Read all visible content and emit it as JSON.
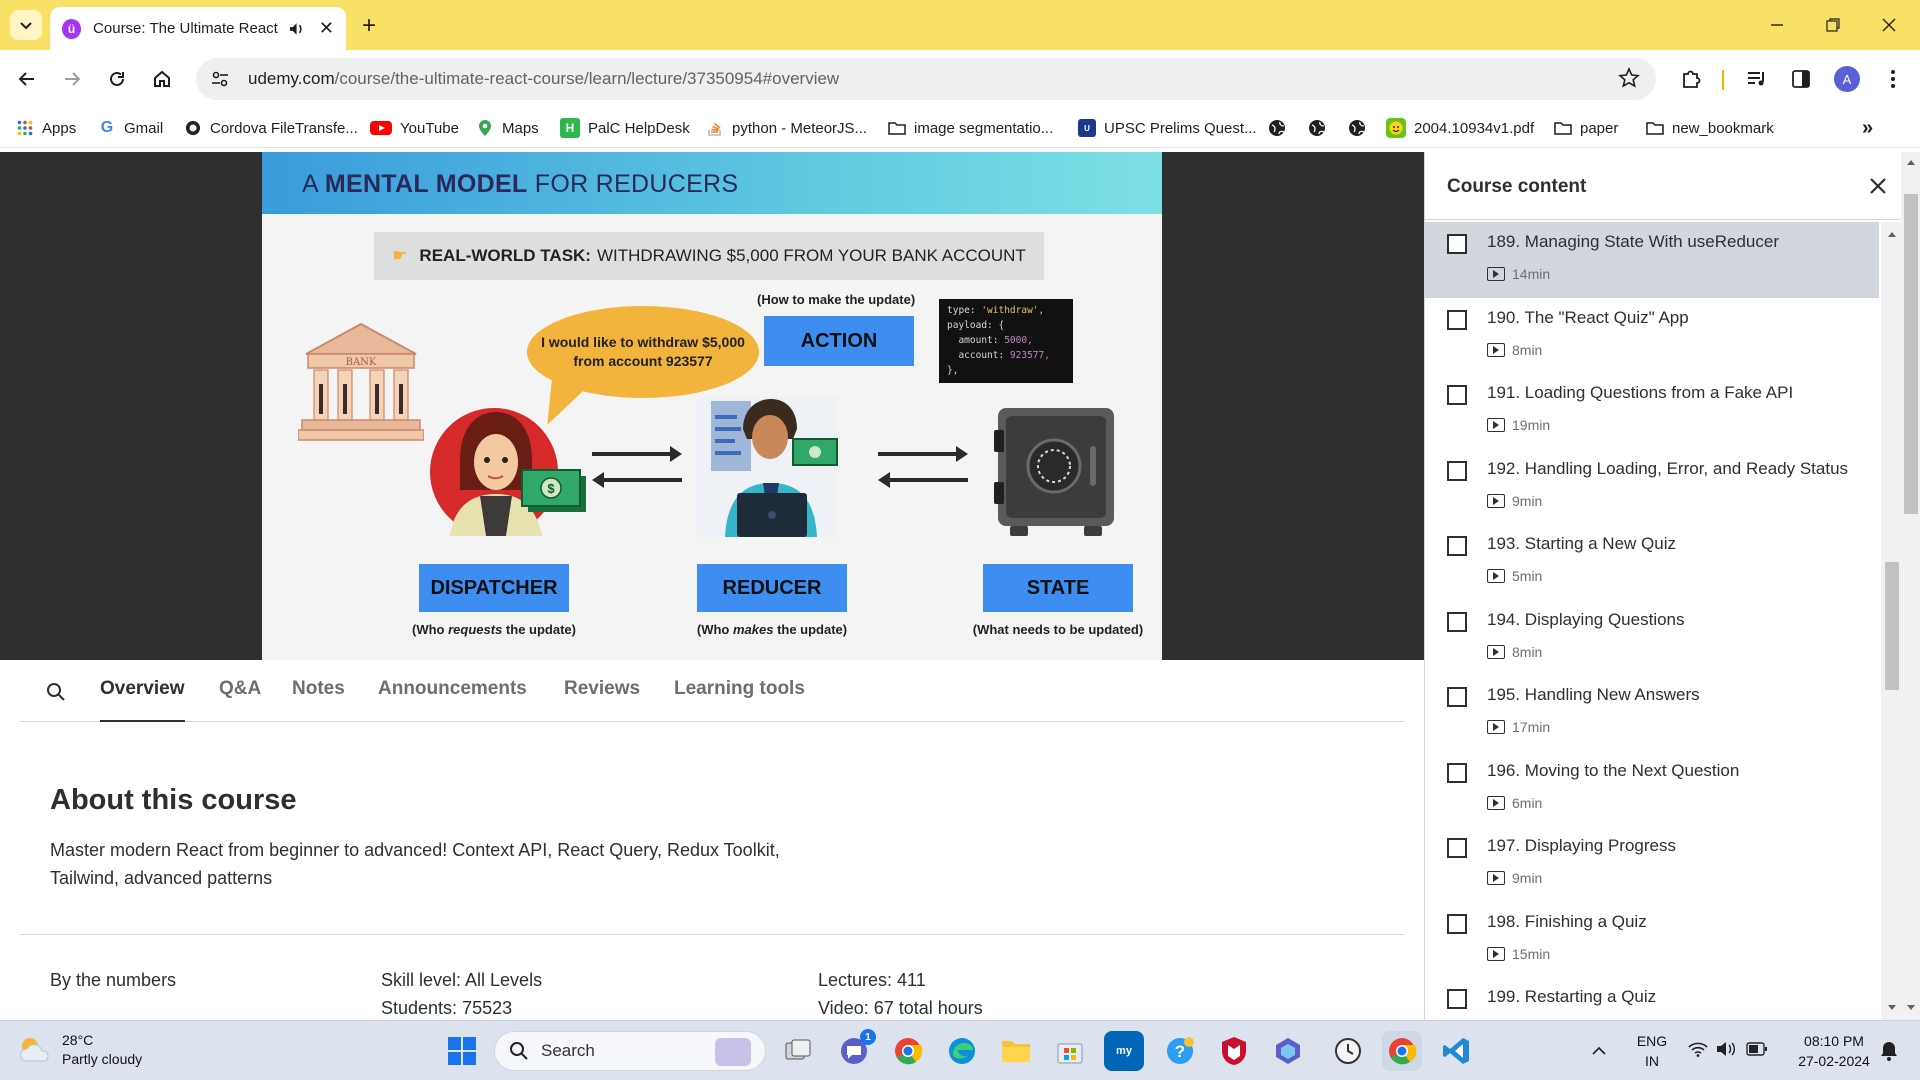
{
  "browser": {
    "tab_title": "Course: The Ultimate React",
    "url_host": "udemy.com",
    "url_path": "/course/the-ultimate-react-course/learn/lecture/37350954#overview",
    "bookmarks": [
      "Apps",
      "Gmail",
      "Cordova FileTransfe...",
      "YouTube",
      "Maps",
      "PalC HelpDesk",
      "python - MeteorJS...",
      "image segmentatio...",
      "UPSC Prelims Quest...",
      "2004.10934v1.pdf",
      "paper",
      "new_bookmark"
    ],
    "profile_initial": "A"
  },
  "slide": {
    "title_prefix": "A ",
    "title_bold": "MENTAL MODEL",
    "title_suffix": " FOR REDUCERS",
    "task_bold": "REAL-WORLD TASK:",
    "task_rest": "WITHDRAWING $5,000 FROM YOUR BANK ACCOUNT",
    "how_label": "(How to make the update)",
    "action_label": "ACTION",
    "bubble_text": "I would like to withdraw $5,000 from account 923577",
    "bank_label": "BANK",
    "dispatcher_label": "DISPATCHER",
    "reducer_label": "REDUCER",
    "state_label": "STATE",
    "dispatcher_sub_pre": "(Who ",
    "dispatcher_sub_em": "requests",
    "dispatcher_sub_post": " the update)",
    "reducer_sub_pre": "(Who ",
    "reducer_sub_em": "makes",
    "reducer_sub_post": " the update)",
    "state_sub": "(What needs to be updated)",
    "code": {
      "l1_key": "type: ",
      "l1_val": "'withdraw',",
      "l2": "payload: {",
      "l3_key": "  amount: ",
      "l3_val": "5000,",
      "l4_key": "  account: ",
      "l4_val": "923577,",
      "l5": "},"
    }
  },
  "lesson_tabs": [
    "Overview",
    "Q&A",
    "Notes",
    "Announcements",
    "Reviews",
    "Learning tools"
  ],
  "active_tab": "Overview",
  "about": {
    "title": "About this course",
    "description": "Master modern React from beginner to advanced! Context API, React Query, Redux Toolkit, Tailwind, advanced patterns",
    "by_numbers": "By the numbers",
    "skill_level": "Skill level: All Levels",
    "students": "Students: 75523",
    "lectures": "Lectures: 411",
    "video": "Video: 67 total hours"
  },
  "sidebar": {
    "title": "Course content",
    "lectures": [
      {
        "title": "189. Managing State With useReducer",
        "duration": "14min",
        "current": true
      },
      {
        "title": "190. The \"React Quiz\" App",
        "duration": "8min"
      },
      {
        "title": "191. Loading Questions from a Fake API",
        "duration": "19min"
      },
      {
        "title": "192. Handling Loading, Error, and Ready Status",
        "duration": "9min"
      },
      {
        "title": "193. Starting a New Quiz",
        "duration": "5min"
      },
      {
        "title": "194. Displaying Questions",
        "duration": "8min"
      },
      {
        "title": "195. Handling New Answers",
        "duration": "17min"
      },
      {
        "title": "196. Moving to the Next Question",
        "duration": "6min"
      },
      {
        "title": "197. Displaying Progress",
        "duration": "9min"
      },
      {
        "title": "198. Finishing a Quiz",
        "duration": "15min"
      },
      {
        "title": "199. Restarting a Quiz",
        "duration": ""
      }
    ]
  },
  "taskbar": {
    "temperature": "28°C",
    "weather": "Partly cloudy",
    "search_placeholder": "Search",
    "lang": "ENG",
    "region": "IN",
    "time": "08:10 PM",
    "date": "27-02-2024",
    "teams_badge": "1"
  },
  "colors": {
    "titlebar": "#f9e066",
    "udemy_purple": "#a435f0",
    "slide_blue": "#3d8ef0",
    "bubble": "#f2b43c",
    "current_lecture": "#d1d7dc"
  }
}
